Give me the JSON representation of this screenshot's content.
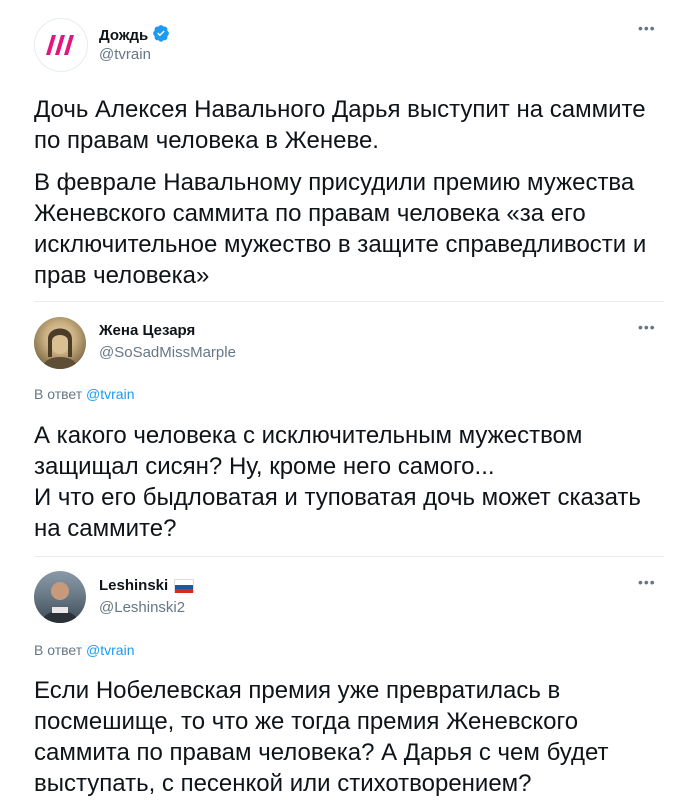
{
  "tweet1": {
    "author_name": "Дождь",
    "author_handle": "@tvrain",
    "more_icon": "more-dots-icon",
    "paragraph1": "Дочь Алексея Навального Дарья выступит на саммите по правам человека в Женеве.",
    "paragraph2": "В феврале Навальному присудили премию мужества Женевского саммита по правам человека «за его исключительное мужество в защите справедливости и прав человека»"
  },
  "tweet2": {
    "author_name": "Жена Цезаря",
    "author_handle": "@SoSadMissMarple",
    "reply_prefix": "В ответ",
    "reply_to": "@tvrain",
    "text_line1": "А какого человека с исключительным мужеством защищал сисян? Ну, кроме него самого...",
    "text_line2": "И что его быдловатая и туповатая дочь может сказать на саммите?"
  },
  "tweet3": {
    "author_name": "Leshinski",
    "author_handle": "@Leshinski2",
    "reply_prefix": "В ответ",
    "reply_to": "@tvrain",
    "text": "Если Нобелевская премия уже превратилась в посмешище, то что же тогда премия Женевского саммита по правам человека? А Дарья с чем будет выступать, с песенкой или стихотворением?"
  },
  "colors": {
    "accent": "#1d9bf0",
    "tvrain_brand": "#e5147e",
    "secondary_text": "#657786"
  }
}
